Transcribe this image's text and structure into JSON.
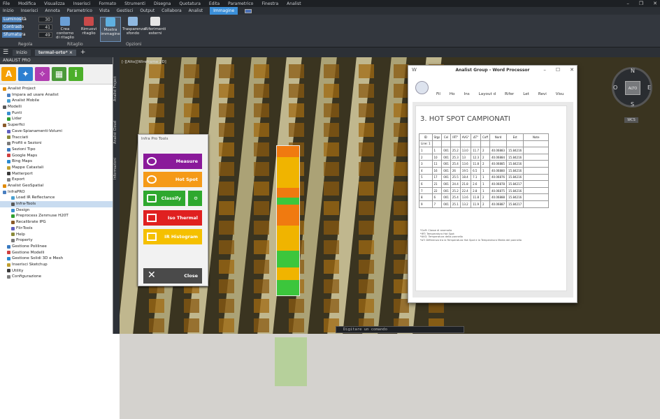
{
  "menubar": {
    "items": [
      "File",
      "Modifica",
      "Visualizza",
      "Inserisci",
      "Formato",
      "Strumenti",
      "Disegna",
      "Quotatura",
      "Edita",
      "Parametrico",
      "Finestra",
      "Analist"
    ]
  },
  "ribbon_tabs": {
    "items": [
      "Inizio",
      "Inserisci",
      "Annota",
      "Parametrico",
      "Vista",
      "Gestisci",
      "Output",
      "Collabora",
      "Analist"
    ],
    "active": "Immagine"
  },
  "ribbon": {
    "rows": [
      {
        "label": "Luminosità",
        "value": "30"
      },
      {
        "label": "Contrasto",
        "value": "41"
      },
      {
        "label": "Sfumatura",
        "value": "49"
      }
    ],
    "group_regola": "Regola",
    "group_ritaglio": "Ritaglio",
    "group_opzioni": "Opzioni",
    "buttons": [
      "Crea contorno di ritaglio",
      "Rimuovi ritaglio",
      "Mostra immagine",
      "Trasparenza sfondo",
      "Riferimenti esterni"
    ]
  },
  "doc_tabs": {
    "home": "Inizio",
    "file": "termal-orto*",
    "add": "+"
  },
  "left_panel": {
    "title": "ANALIST PRO",
    "tree": [
      "Analist Project",
      "Impara ad usare Analist",
      "Analist Mobile",
      "Modelli",
      "Punti",
      "Lidar",
      "Superfici",
      "Cave-Spianamenti-Volumi",
      "Tracciati",
      "Profili e Sezioni",
      "Sezioni Tipo",
      "Google Maps",
      "Bing Maps",
      "Mappe Catastali",
      "Matterport",
      "Export",
      "Analist GeoSpatial",
      "InfraPRO",
      "Load IR Reflectance",
      "Infra-Tools",
      "Design",
      "Preprocess Zenmuse H20T",
      "Recalibrate IPG",
      "Flir-Tools",
      "Help",
      "Property",
      "Gestione Polilinee",
      "Gestione Modelli",
      "Gestione Solidi 3D e Mesh",
      "Inserisci Sketchup",
      "Utility",
      "Configurazione"
    ]
  },
  "side_tabs": [
    "Analist Project",
    "Analist Cloud",
    "Informazioni"
  ],
  "viewport": {
    "label": "[-][Alto][Wireframe 2D]"
  },
  "infra_tools": {
    "title": "Infra Pro Tools",
    "buttons": [
      "Measure",
      "Hot Spot",
      "Classify",
      "Iso Thermal",
      "IR Histogram",
      "Close"
    ]
  },
  "word": {
    "title": "Analist Group - Word Processor",
    "menu": [
      "Fil",
      "Ho",
      "Ins",
      "Layout d",
      "Rifer",
      "Let",
      "Revi",
      "Visu"
    ],
    "heading": "3. HOT SPOT CAMPIONATI",
    "headers": [
      "ID",
      "Stgs",
      "Cel",
      "IRT°",
      "AVG°",
      "ΔT°",
      "Coff",
      "Nord",
      "Est",
      "Note"
    ],
    "rows": [
      [
        "Line: 1",
        "",
        "",
        "",
        "",
        "",
        "",
        "",
        "",
        ""
      ],
      [
        "1",
        "1",
        "001",
        "25.2",
        "13.0",
        "11.7",
        "2",
        "40.06883",
        "15.84216",
        ""
      ],
      [
        "2",
        "10",
        "001",
        "25.3",
        "13",
        "12.3",
        "2",
        "40.06884",
        "15.84216",
        ""
      ],
      [
        "3",
        "11",
        "001",
        "25.4",
        "13.6",
        "11.8",
        "2",
        "40.06885",
        "15.84216",
        ""
      ],
      [
        "4",
        "16",
        "001",
        "26",
        "19.5",
        "6.5",
        "1",
        "40.06880",
        "15.84216",
        ""
      ],
      [
        "5",
        "17",
        "001",
        "25.5",
        "18.4",
        "7.1",
        "1",
        "40.06876",
        "15.84216",
        ""
      ],
      [
        "6",
        "21",
        "001",
        "24.4",
        "21.8",
        "2.6",
        "1",
        "40.06878",
        "15.84217",
        ""
      ],
      [
        "7",
        "22",
        "001",
        "25.2",
        "22.4",
        "2.8",
        "1",
        "40.06875",
        "15.84216",
        ""
      ],
      [
        "8",
        "6",
        "001",
        "25.4",
        "13.6",
        "11.8",
        "2",
        "40.06888",
        "15.84216",
        ""
      ],
      [
        "9",
        "7",
        "001",
        "25.1",
        "13.2",
        "11.9",
        "2",
        "40.06887",
        "15.84217",
        ""
      ]
    ],
    "notes": [
      "*Coff: Classe di anomalia",
      "*IRT: Temperatura Hot Spot",
      "*AVG: Temperatura della pannello",
      "*ΔT: Differenza tra la Temperatura Hot Spot e la Temperatura Media del pannello"
    ]
  },
  "compass": {
    "n": "N",
    "s": "S",
    "e": "E",
    "o": "O",
    "center": "ALTO",
    "wcs": "WCS"
  },
  "command": {
    "placeholder": "Digitare un comando"
  }
}
